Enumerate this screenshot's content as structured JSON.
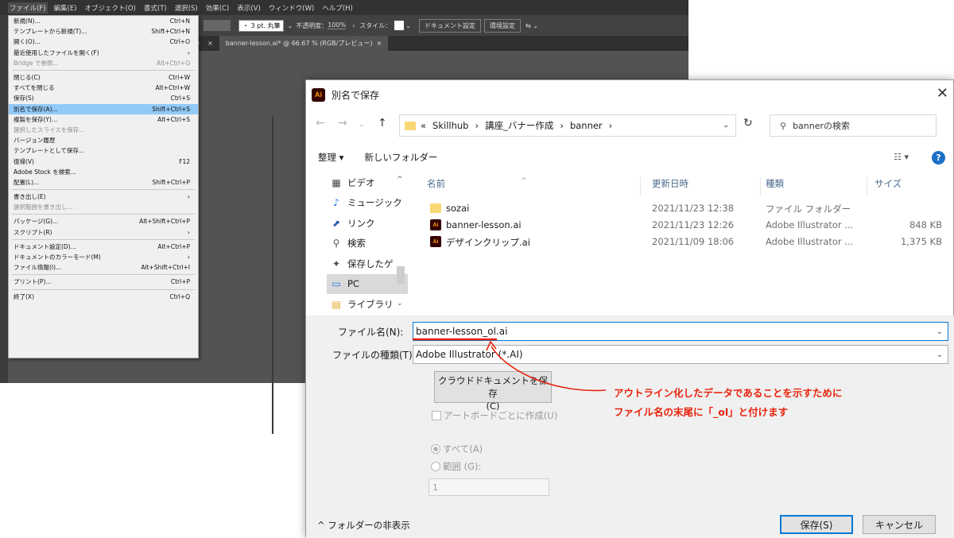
{
  "ai_app": {
    "menubar": [
      "ファイル(F)",
      "編集(E)",
      "オブジェクト(O)",
      "書式(T)",
      "選択(S)",
      "効果(C)",
      "表示(V)",
      "ウィンドウ(W)",
      "ヘルプ(H)"
    ],
    "control_bar": {
      "stroke": "・ 3 pt. 丸筆",
      "opacity_label": "不透明度：",
      "opacity_value": "100%",
      "style_label": "スタイル：",
      "doc_settings": "ドキュメント設定",
      "preferences": "環境設定"
    },
    "tab_left": "）",
    "tab_title": "banner-lesson.ai* @ 66.67 % (RGB/プレビュー)"
  },
  "file_menu": {
    "items": [
      {
        "label": "新規(N)...",
        "shortcut": "Ctrl+N",
        "state": ""
      },
      {
        "label": "テンプレートから新規(T)...",
        "shortcut": "Shift+Ctrl+N",
        "state": ""
      },
      {
        "label": "開く(O)...",
        "shortcut": "Ctrl+O",
        "state": ""
      },
      {
        "label": "最近使用したファイルを開く(F)",
        "shortcut": "",
        "state": "sub"
      },
      {
        "label": "Bridge で参照...",
        "shortcut": "Alt+Ctrl+O",
        "state": "dis"
      },
      {
        "sep": true
      },
      {
        "label": "閉じる(C)",
        "shortcut": "Ctrl+W",
        "state": ""
      },
      {
        "label": "すべてを閉じる",
        "shortcut": "Alt+Ctrl+W",
        "state": ""
      },
      {
        "label": "保存(S)",
        "shortcut": "Ctrl+S",
        "state": ""
      },
      {
        "label": "別名で保存(A)...",
        "shortcut": "Shift+Ctrl+S",
        "state": "hl"
      },
      {
        "label": "複製を保存(Y)...",
        "shortcut": "Alt+Ctrl+S",
        "state": ""
      },
      {
        "label": "選択したスライスを保存...",
        "shortcut": "",
        "state": "dis"
      },
      {
        "label": "バージョン履歴",
        "shortcut": "",
        "state": ""
      },
      {
        "label": "テンプレートとして保存...",
        "shortcut": "",
        "state": ""
      },
      {
        "label": "復帰(V)",
        "shortcut": "F12",
        "state": ""
      },
      {
        "label": "Adobe Stock を検索...",
        "shortcut": "",
        "state": ""
      },
      {
        "label": "配置(L)...",
        "shortcut": "Shift+Ctrl+P",
        "state": ""
      },
      {
        "sep": true
      },
      {
        "label": "書き出し(E)",
        "shortcut": "",
        "state": "sub"
      },
      {
        "label": "選択範囲を書き出し...",
        "shortcut": "",
        "state": "dis"
      },
      {
        "sep": true
      },
      {
        "label": "パッケージ(G)...",
        "shortcut": "Alt+Shift+Ctrl+P",
        "state": ""
      },
      {
        "label": "スクリプト(R)",
        "shortcut": "",
        "state": "sub"
      },
      {
        "sep": true
      },
      {
        "label": "ドキュメント設定(D)...",
        "shortcut": "Alt+Ctrl+P",
        "state": ""
      },
      {
        "label": "ドキュメントのカラーモード(M)",
        "shortcut": "",
        "state": "sub"
      },
      {
        "label": "ファイル情報(I)...",
        "shortcut": "Alt+Shift+Ctrl+I",
        "state": ""
      },
      {
        "sep": true
      },
      {
        "label": "プリント(P)...",
        "shortcut": "Ctrl+P",
        "state": ""
      },
      {
        "sep": true
      },
      {
        "label": "終了(X)",
        "shortcut": "Ctrl+Q",
        "state": ""
      }
    ]
  },
  "dialog": {
    "title": "別名で保存",
    "breadcrumb": [
      "«",
      "Skillhub",
      "›",
      "講座_バナー作成",
      "›",
      "banner",
      "›"
    ],
    "search_placeholder": "bannerの検索",
    "organize": "整理 ▾",
    "new_folder": "新しいフォルダー",
    "nav_items": [
      {
        "label": "ビデオ",
        "icon": "video-icon"
      },
      {
        "label": "ミュージック",
        "icon": "music-icon"
      },
      {
        "label": "リンク",
        "icon": "link-icon"
      },
      {
        "label": "検索",
        "icon": "search-icon"
      },
      {
        "label": "保存したゲ",
        "icon": "saved-games-icon"
      },
      {
        "label": "PC",
        "icon": "pc-icon"
      },
      {
        "label": "ライブラリ",
        "icon": "library-icon"
      }
    ],
    "columns": {
      "name": "名前",
      "modified": "更新日時",
      "type": "種類",
      "size": "サイズ"
    },
    "files": [
      {
        "name": "sozai",
        "modified": "2021/11/23 12:38",
        "type": "ファイル フォルダー",
        "size": "",
        "icon": "folder"
      },
      {
        "name": "banner-lesson.ai",
        "modified": "2021/11/23 12:26",
        "type": "Adobe Illustrator ...",
        "size": "848 KB",
        "icon": "ai"
      },
      {
        "name": "デザインクリップ.ai",
        "modified": "2021/11/09 18:06",
        "type": "Adobe Illustrator ...",
        "size": "1,375 KB",
        "icon": "ai"
      }
    ],
    "filename_label": "ファイル名(N):",
    "filename_value": "banner-lesson_ol.ai",
    "filetype_label": "ファイルの種類(T):",
    "filetype_value": "Adobe Illustrator (*.AI)",
    "cloud_btn_line1": "クラウドドキュメントを保存",
    "cloud_btn_line2": "(C)",
    "artboard_check": "アートボードごとに作成(U)",
    "radio_all": "すべて(A)",
    "radio_range": "範囲 (G):",
    "range_value": "1",
    "hide_folders": "フォルダーの非表示",
    "save": "保存(S)",
    "cancel": "キャンセル"
  },
  "annotation": {
    "line1": "アウトライン化したデータであることを示すために",
    "line2": "ファイル名の末尾に「_ol」と付けます",
    "color": "#e8230d"
  }
}
